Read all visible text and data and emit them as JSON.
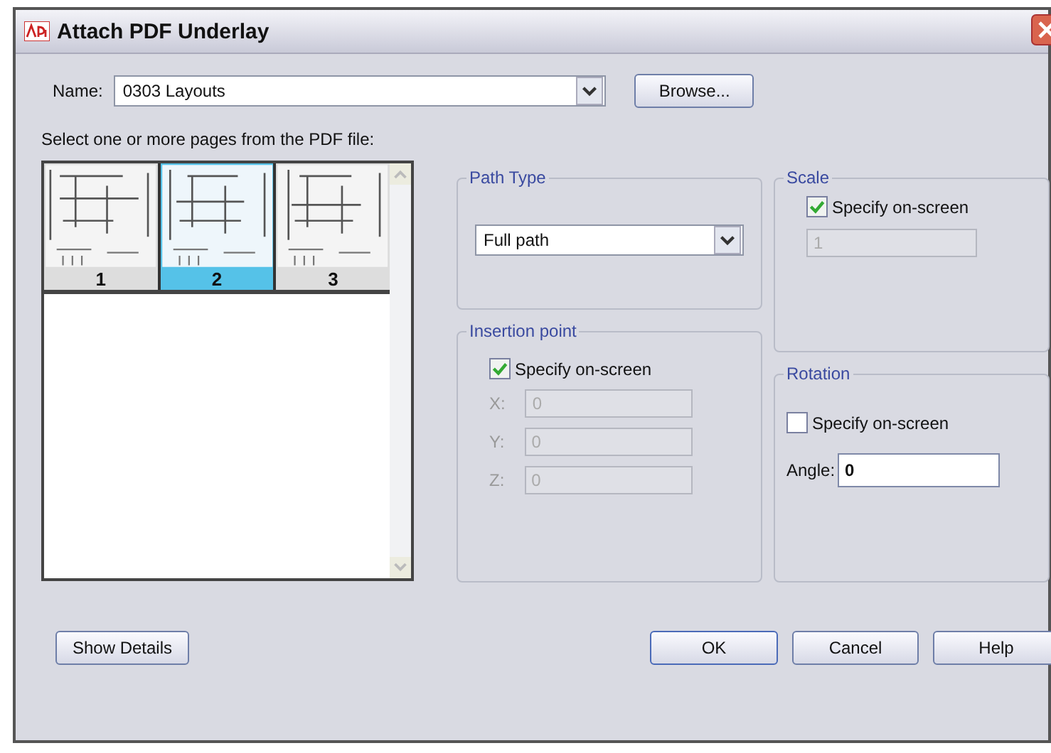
{
  "window": {
    "title": "Attach PDF Underlay"
  },
  "name_field": {
    "label": "Name:",
    "value": "0303 Layouts"
  },
  "browse_button": "Browse...",
  "pages_label": "Select one or more pages from the PDF file:",
  "pages": [
    {
      "label": "1",
      "selected": false
    },
    {
      "label": "2",
      "selected": true
    },
    {
      "label": "3",
      "selected": false
    }
  ],
  "path_type": {
    "title": "Path Type",
    "value": "Full path"
  },
  "scale": {
    "title": "Scale",
    "specify": {
      "label": "Specify on-screen",
      "checked": true
    },
    "value": "1"
  },
  "insertion": {
    "title": "Insertion point",
    "specify": {
      "label": "Specify on-screen",
      "checked": true
    },
    "fields": [
      {
        "label": "X:",
        "value": "0"
      },
      {
        "label": "Y:",
        "value": "0"
      },
      {
        "label": "Z:",
        "value": "0"
      }
    ]
  },
  "rotation": {
    "title": "Rotation",
    "specify": {
      "label": "Specify on-screen",
      "checked": false
    },
    "angle": {
      "label": "Angle:",
      "value": "0"
    }
  },
  "buttons": {
    "details": "Show Details",
    "ok": "OK",
    "cancel": "Cancel",
    "help": "Help"
  }
}
